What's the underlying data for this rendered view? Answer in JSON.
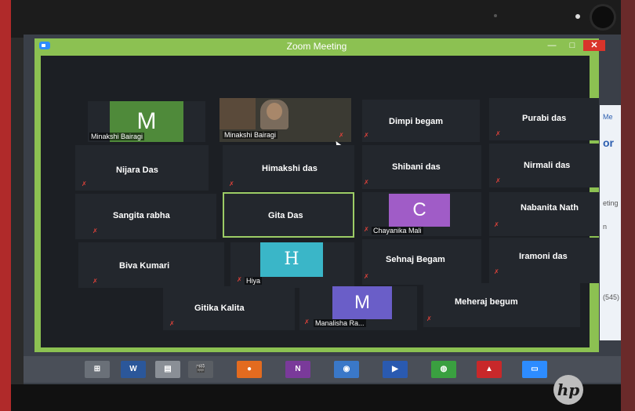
{
  "window": {
    "title": "Zoom Meeting",
    "minimize_label": "—",
    "maximize_label": "□",
    "close_label": "✕"
  },
  "participants": [
    {
      "id": "minakshi-avatar",
      "name": "Minakshi Bairagi",
      "avatar_letter": "M",
      "avatar_color": "#4f8a3a"
    },
    {
      "id": "minakshi-video",
      "name": "Minakshi Bairagi"
    },
    {
      "id": "dimpi",
      "name": "Dimpi begam"
    },
    {
      "id": "purabi",
      "name": "Purabi das"
    },
    {
      "id": "nijara",
      "name": "Nijara Das"
    },
    {
      "id": "himakshi",
      "name": "Himakshi das"
    },
    {
      "id": "shibani",
      "name": "Shibani das"
    },
    {
      "id": "nirmali",
      "name": "Nirmali das"
    },
    {
      "id": "sangita",
      "name": "Sangita rabha"
    },
    {
      "id": "gita",
      "name": "Gita Das"
    },
    {
      "id": "chayanika",
      "name": "Chayanika Mali",
      "avatar_letter": "C",
      "avatar_color": "#a05cc7"
    },
    {
      "id": "nabanita",
      "name": "Nabanita Nath"
    },
    {
      "id": "biva",
      "name": "Biva Kumari"
    },
    {
      "id": "hiya",
      "name": "Hiya",
      "avatar_letter": "H",
      "avatar_color": "#3ab6c8"
    },
    {
      "id": "sehnaj",
      "name": "Sehnaj Begam"
    },
    {
      "id": "iramoni",
      "name": "Iramoni das"
    },
    {
      "id": "gitika",
      "name": "Gitika Kalita"
    },
    {
      "id": "manalisha",
      "name": "Manalisha Ra...",
      "avatar_letter": "M",
      "avatar_color": "#6a5ec8"
    },
    {
      "id": "meheraj",
      "name": "Meheraj begum"
    }
  ],
  "background_app": {
    "fragments": [
      "Me",
      "or",
      "eting",
      "n",
      "(545)"
    ]
  },
  "taskbar": {
    "word_label": "W",
    "onenote_label": "N"
  },
  "device": {
    "brand": "hp"
  },
  "colors": {
    "window_frame": "#8cc152",
    "close_button": "#d9342b",
    "active_speaker_border": "#9ccc65",
    "muted_icon": "#e0423a"
  }
}
